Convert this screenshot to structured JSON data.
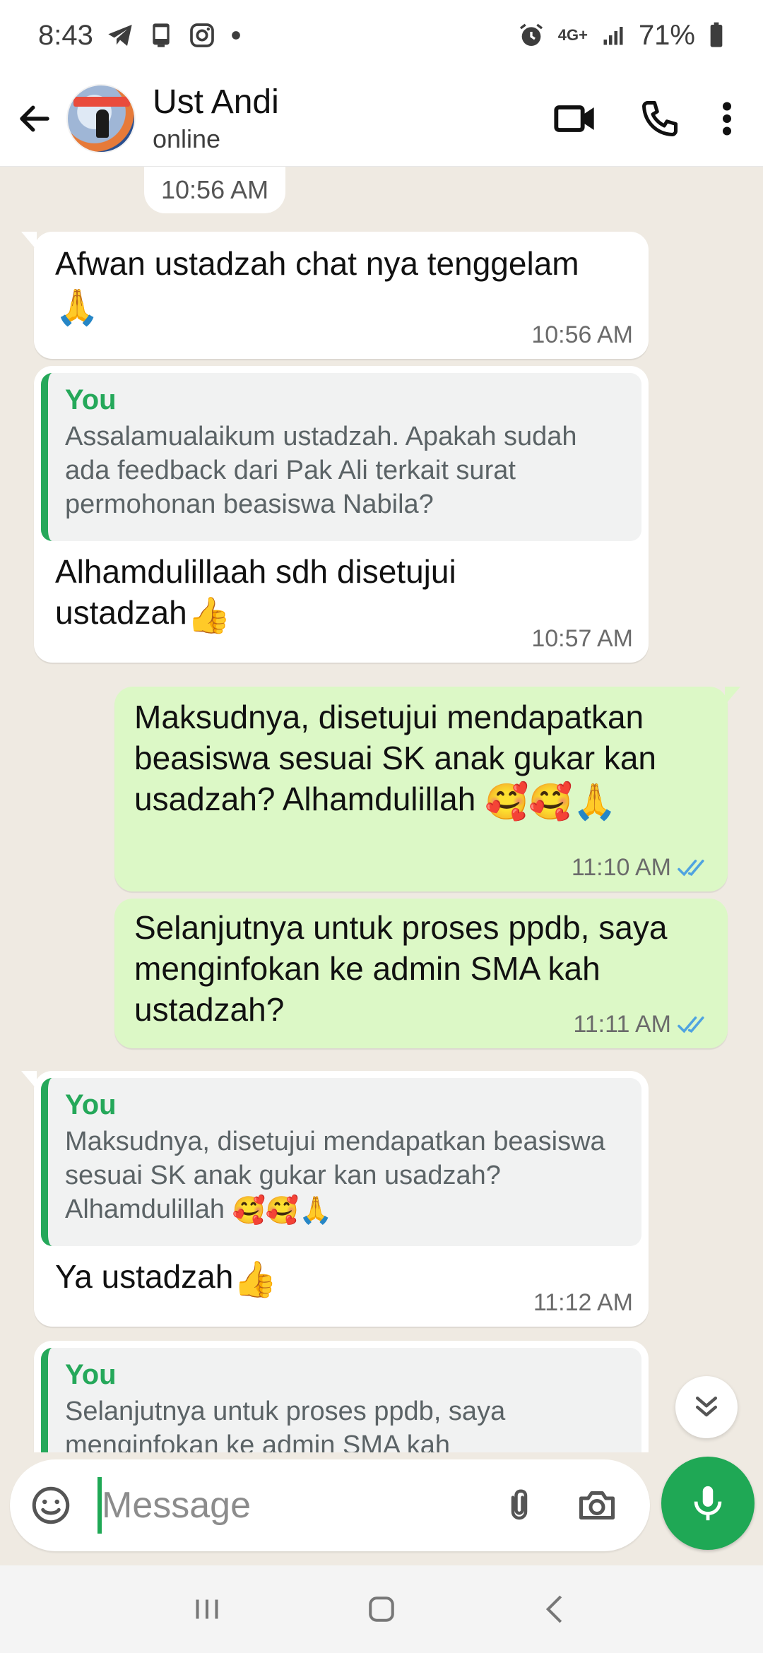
{
  "status_bar": {
    "time": "8:43",
    "network": "4G+",
    "battery": "71%"
  },
  "header": {
    "contact_name": "Ust Andi",
    "contact_status": "online"
  },
  "chat": {
    "date_chip": "10:56 AM",
    "messages": [
      {
        "direction": "in",
        "text": "Afwan ustadzah chat nya tenggelam",
        "emoji": "🙏",
        "time": "10:56 AM"
      },
      {
        "direction": "in",
        "quote_author": "You",
        "quote_text": "Assalamualaikum ustadzah. Apakah sudah ada feedback dari Pak Ali terkait surat permohonan beasiswa Nabila?",
        "text": "Alhamdulillaah sdh disetujui ustadzah",
        "emoji": "👍",
        "time": "10:57 AM"
      },
      {
        "direction": "out",
        "text": "Maksudnya, disetujui mendapatkan beasiswa sesuai SK anak gukar kan usadzah? Alhamdulillah",
        "emoji": "🥰🥰🙏",
        "time": "11:10 AM",
        "status": "read"
      },
      {
        "direction": "out",
        "text": "Selanjutnya untuk proses ppdb, saya menginfokan ke admin SMA kah ustadzah?",
        "time": "11:11 AM",
        "status": "read"
      },
      {
        "direction": "in",
        "quote_author": "You",
        "quote_text": "Maksudnya, disetujui mendapatkan beasiswa sesuai SK anak gukar kan usadzah? Alhamdulillah",
        "quote_emoji": "🥰🥰🙏",
        "text": "Ya ustadzah",
        "emoji": "👍",
        "time": "11:12 AM"
      },
      {
        "direction": "in",
        "quote_author": "You",
        "quote_text": "Selanjutnya untuk proses ppdb, saya menginfokan ke admin SMA kah"
      }
    ]
  },
  "composer": {
    "placeholder": "Message"
  },
  "colors": {
    "accent_green": "#1fa855",
    "outgoing_bubble": "#dcf8c6",
    "chat_background": "#efeae2",
    "read_tick_blue": "#4fa3e0"
  }
}
